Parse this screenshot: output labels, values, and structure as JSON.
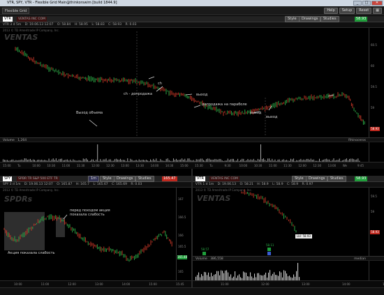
{
  "window": {
    "title": "VTR, SPY, VTR - Flexible Grid Main@thinkorswim [build 1844.9]",
    "buttons": {
      "minimize": "_",
      "maximize": "□",
      "close": "✕"
    }
  },
  "toolbar": {
    "flexible_grid_tab": "Flexible Grid",
    "help": "Help",
    "setup": "Setup",
    "reset": "Reset"
  },
  "panels": {
    "top": {
      "symbol": "VTR",
      "description": "VENTAS INC COM",
      "right_price": "58.93",
      "style": "Style",
      "drawings": "Drawings",
      "studies": "Studies",
      "info": {
        "period": "VTR 3 d 5m",
        "date": "D: 19.06.13 12:07",
        "open": "O: 58.84",
        "high": "H: 58.95",
        "low": "L: 58.83",
        "close": "C: 58.93",
        "change": "R: 0.03"
      },
      "copyright": "2013 © TD Ameritrade IP Company, Inc.",
      "watermark": "VENTAS",
      "annotations": [
        "ch",
        "ch - допродажа",
        "выход",
        "допродажа на параболе",
        "выход",
        "выход",
        "Выход объема"
      ],
      "y_ticks": [
        "60.5",
        "60",
        "59.5",
        "59",
        "58.93"
      ],
      "x_ticks": [
        "15:00",
        "Tu",
        "10:00",
        "10:30",
        "11:00",
        "11:30",
        "12:00",
        "12:30",
        "13:00",
        "13:30",
        "14:00",
        "14:30",
        "15:00",
        "15:30",
        "Tu",
        "9:30",
        "10:00",
        "10:30",
        "11:00",
        "11:30",
        "12:00",
        "12:30",
        "13:00",
        "We",
        "9:45"
      ],
      "last_price": "58.93",
      "volume_label": "Volume",
      "volume_value": "1,264",
      "volume_right": "Rhinoceros"
    },
    "bottom_left": {
      "symbol": "SPY",
      "description": "SPDR TR S&P 500 ETF TR",
      "right_price": "165.47",
      "right_price_tag": "1m",
      "style": "Style",
      "drawings": "Drawings",
      "studies": "Studies",
      "info": {
        "period": "SPY 3 d 1m",
        "date": "D: 19.06.13 12:07",
        "open": "O: 165.87",
        "high": "H: 165.7",
        "low": "L: 165.67",
        "close": "C: 165.69",
        "change": "R: 0.03"
      },
      "copyright": "2013 © TD Ameritrade IP Company, Inc.",
      "watermark": "SPDRs",
      "annotations": [
        "перед походом акция показала слабость",
        "Акция показала слабость"
      ],
      "y_ticks": [
        "167",
        "166.5",
        "166",
        "165.5",
        "165"
      ],
      "x_ticks": [
        "10:00",
        "11:00",
        "12:00",
        "13:00",
        "14:00",
        "15:00",
        "15:45"
      ],
      "last_price": "165.48"
    },
    "bottom_right": {
      "symbol": "VTR",
      "description": "VENTAS INC COM",
      "right_price": "58.93",
      "style": "Style",
      "drawings": "Drawings",
      "studies": "Studies",
      "info": {
        "period": "VTR 1 d 1m",
        "date": "D: 19.06.13",
        "open": "O: 58.21",
        "high": "H: 58.9",
        "low": "L: 58.9",
        "close": "C: 58.9",
        "change": "R: 0.97"
      },
      "copyright": "2013 © TD Ameritrade IP Company, Inc.",
      "watermark": "VENTAS",
      "y_ticks": [
        "59.5",
        "59",
        "58.93"
      ],
      "x_ticks": [
        "11:00",
        "12:00",
        "13:00",
        "14:00",
        "14:10"
      ],
      "last_price": "58.93",
      "price_label": "Lbl: 58.93",
      "marker_buy": "58.57",
      "marker_sell": "58.11",
      "volume_label": "Volume",
      "volume_value": "386,558",
      "volume_right": "median"
    }
  },
  "colors": {
    "up": "#2fb24a",
    "down": "#d23a2a",
    "price_tag_green": "#1e9e3a",
    "price_tag_red": "#c0281e",
    "titlebar": "#cfd8e3"
  }
}
